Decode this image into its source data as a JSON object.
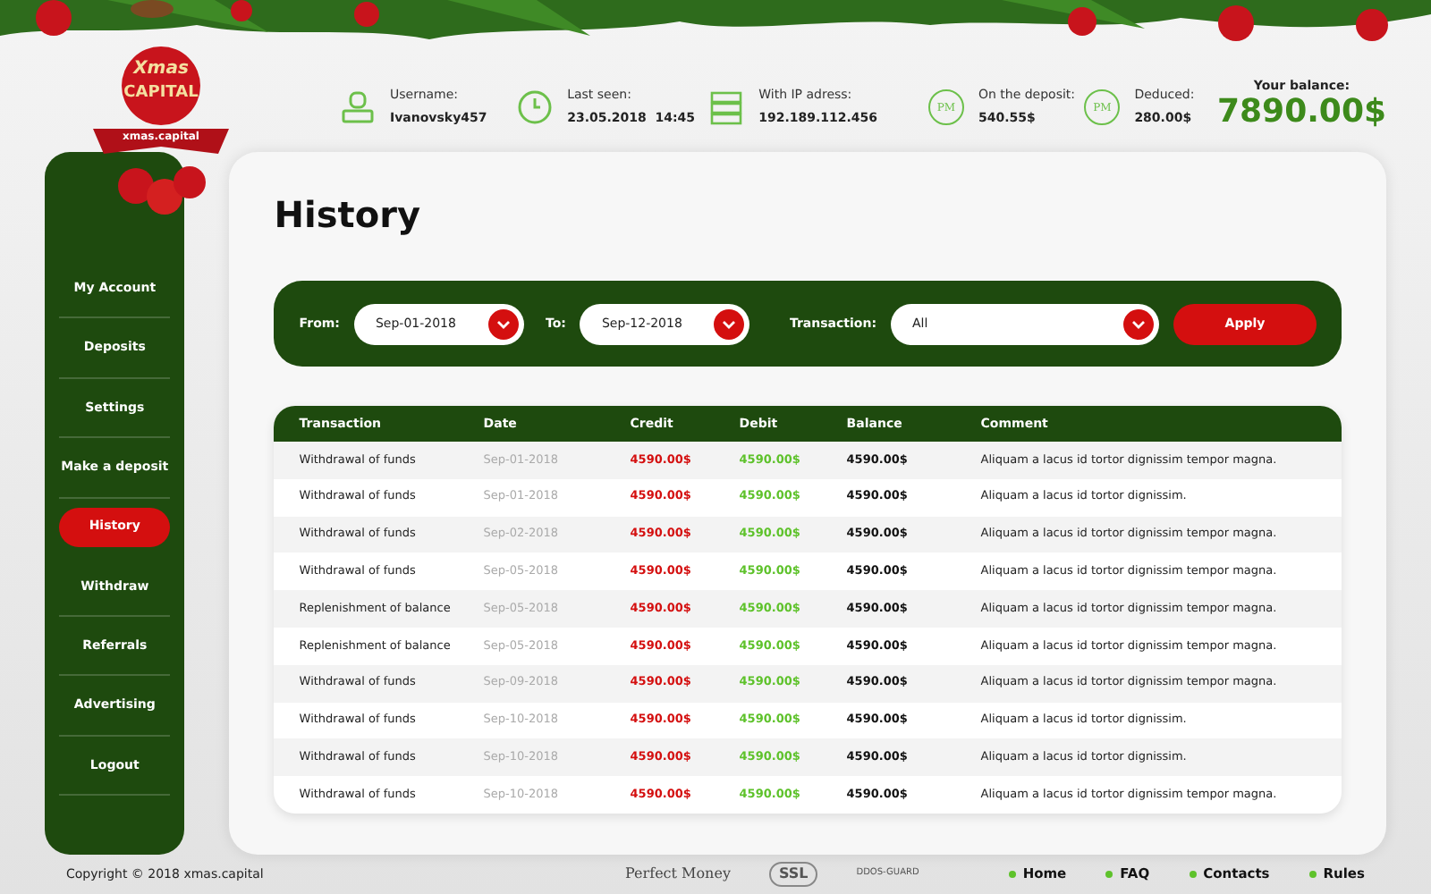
{
  "logo": {
    "title": "Xmas",
    "subtitle": "CAPITAL",
    "ribbon": "xmas.capital"
  },
  "header": {
    "stats": [
      {
        "kind": "user",
        "label": "Username:",
        "value": "Ivanovsky457"
      },
      {
        "kind": "clock",
        "label": "Last seen:",
        "value": "23.05.2018  14:45"
      },
      {
        "kind": "server",
        "label": "With IP adress:",
        "value": "192.189.112.456"
      },
      {
        "kind": "pm",
        "icon_label": "PM",
        "label": "On the deposit:",
        "value": "540.55$"
      },
      {
        "kind": "pm",
        "icon_label": "PM",
        "label": "Deduced:",
        "value": "280.00$"
      }
    ],
    "balance": {
      "label": "Your balance:",
      "value": "7890.00$"
    }
  },
  "sidebar": {
    "items": [
      {
        "label": "My Account",
        "selected": false
      },
      {
        "label": "Deposits",
        "selected": false
      },
      {
        "label": "Settings",
        "selected": false
      },
      {
        "label": "Make a deposit",
        "selected": false
      },
      {
        "label": "History",
        "selected": true
      },
      {
        "label": "Withdraw",
        "selected": false
      },
      {
        "label": "Referrals",
        "selected": false
      },
      {
        "label": "Advertising",
        "selected": false
      },
      {
        "label": "Logout",
        "selected": false
      }
    ]
  },
  "page_title": "History",
  "filters": [
    {
      "label": "From:",
      "value": "Sep-01-2018"
    },
    {
      "label": "To:",
      "value": "Sep-12-2018"
    },
    {
      "label": "Transaction:",
      "value": "All"
    }
  ],
  "apply_button": "Apply",
  "table": {
    "columns": [
      "Transaction",
      "Date",
      "Credit",
      "Debit",
      "Balance",
      "Comment"
    ],
    "rows": [
      [
        "Withdrawal of funds",
        "Sep-01-2018",
        "4590.00$",
        "4590.00$",
        "4590.00$",
        "Aliquam a lacus id tortor dignissim tempor magna."
      ],
      [
        "Withdrawal of funds",
        "Sep-01-2018",
        "4590.00$",
        "4590.00$",
        "4590.00$",
        "Aliquam a lacus id tortor dignissim."
      ],
      [
        "Withdrawal of funds",
        "Sep-02-2018",
        "4590.00$",
        "4590.00$",
        "4590.00$",
        "Aliquam a lacus id tortor dignissim tempor magna."
      ],
      [
        "Withdrawal of funds",
        "Sep-05-2018",
        "4590.00$",
        "4590.00$",
        "4590.00$",
        "Aliquam a lacus id tortor dignissim tempor magna."
      ],
      [
        "Replenishment of balance",
        "Sep-05-2018",
        "4590.00$",
        "4590.00$",
        "4590.00$",
        "Aliquam a lacus id tortor dignissim tempor magna."
      ],
      [
        "Replenishment of balance",
        "Sep-05-2018",
        "4590.00$",
        "4590.00$",
        "4590.00$",
        "Aliquam a lacus id tortor dignissim tempor magna."
      ],
      [
        "Withdrawal of funds",
        "Sep-09-2018",
        "4590.00$",
        "4590.00$",
        "4590.00$",
        "Aliquam a lacus id tortor dignissim tempor magna."
      ],
      [
        "Withdrawal of funds",
        "Sep-10-2018",
        "4590.00$",
        "4590.00$",
        "4590.00$",
        "Aliquam a lacus id tortor dignissim."
      ],
      [
        "Withdrawal of funds",
        "Sep-10-2018",
        "4590.00$",
        "4590.00$",
        "4590.00$",
        "Aliquam a lacus id tortor dignissim."
      ],
      [
        "Withdrawal of funds",
        "Sep-10-2018",
        "4590.00$",
        "4590.00$",
        "4590.00$",
        "Aliquam a lacus id tortor dignissim tempor magna."
      ]
    ]
  },
  "footer": {
    "copyright": "Copyright © 2018 xmas.capital",
    "badges": [
      {
        "kind": "perfect-money",
        "label": "Perfect Money"
      },
      {
        "kind": "ssl",
        "label": "SSL"
      },
      {
        "kind": "ddos",
        "label": "DDOS-GUARD"
      }
    ],
    "links": [
      "Home",
      "FAQ",
      "Contacts",
      "Rules"
    ]
  }
}
